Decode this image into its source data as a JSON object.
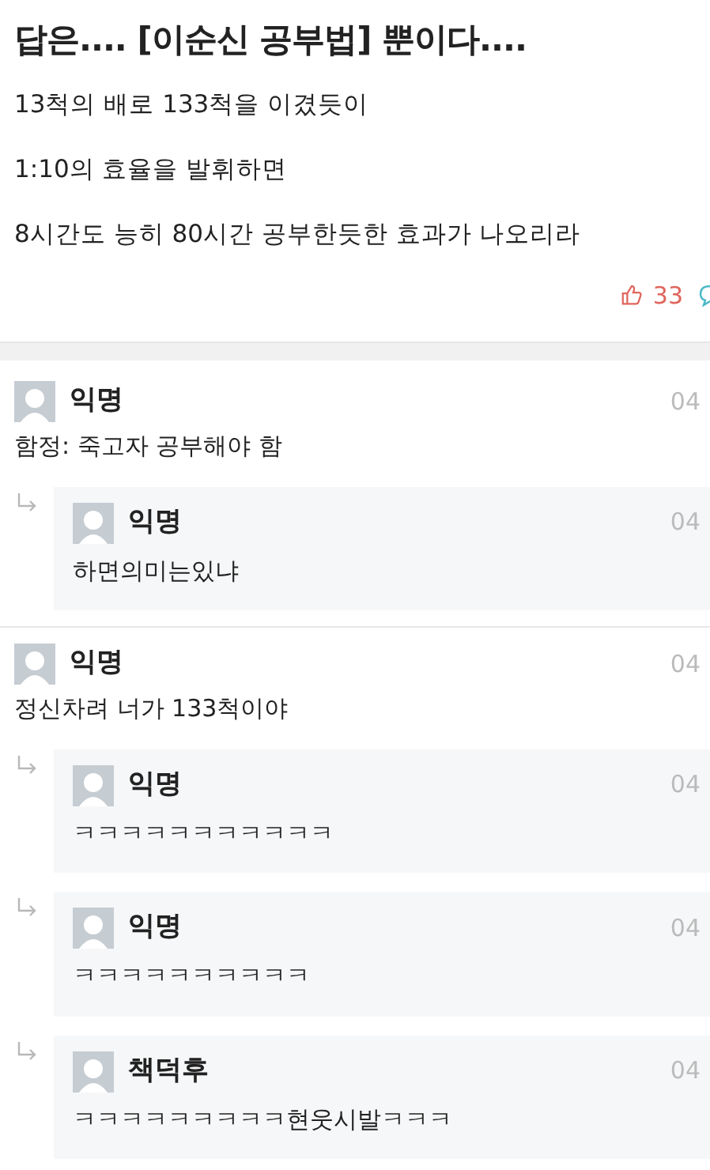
{
  "post": {
    "title": "답은.... [이순신 공부법] 뿐이다....",
    "paragraphs": [
      "13척의 배로 133척을 이겼듯이",
      "1:10의 효율을 발휘하면",
      "8시간도 능히 80시간 공부한듯한 효과가 나오리라"
    ],
    "likes": "33"
  },
  "comments": [
    {
      "author": "익명",
      "date": "04",
      "text": "함정: 죽고자 공부해야 함",
      "children": [
        {
          "author": "익명",
          "date": "04",
          "text": "하면의미는있냐"
        }
      ]
    },
    {
      "author": "익명",
      "date": "04",
      "text": "정신차려 너가 133척이야",
      "children": [
        {
          "author": "익명",
          "date": "04",
          "text": "ㅋㅋㅋㅋㅋㅋㅋㅋㅋㅋㅋ"
        },
        {
          "author": "익명",
          "date": "04",
          "text": "ㅋㅋㅋㅋㅋㅋㅋㅋㅋㅋ"
        },
        {
          "author": "책덕후",
          "date": "04",
          "text": "ㅋㅋㅋㅋㅋㅋㅋㅋㅋ현웃시발ㅋㅋㅋ"
        }
      ]
    }
  ]
}
